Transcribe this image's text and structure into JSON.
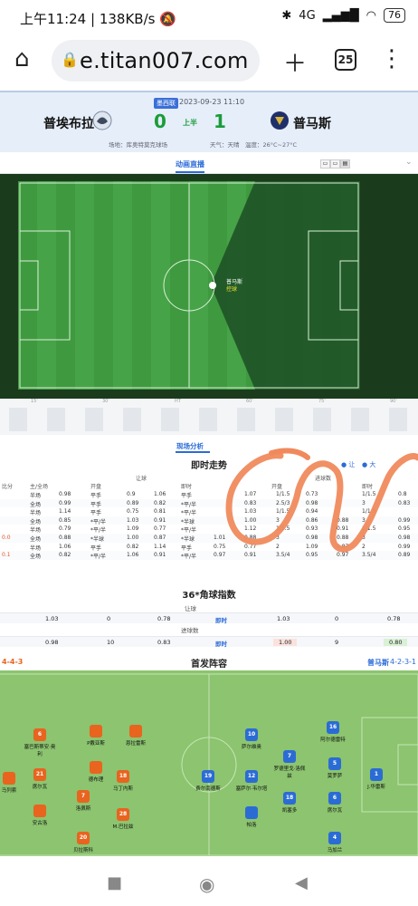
{
  "status_bar": {
    "time": "上午11:24",
    "speed": "138KB/s",
    "network": "4G",
    "battery": "76"
  },
  "browser": {
    "url": "e.titan007.com",
    "tab_count": "25"
  },
  "match": {
    "league": "墨西联",
    "datetime": "2023-09-23 11:10",
    "home_team": "普埃布拉",
    "away_team": "普马斯",
    "home_score": "0",
    "away_score": "1",
    "period": "上半",
    "venue": "场地：库奥特莫克球场",
    "weather": "天气：天晴　温度：26°C~27°C"
  },
  "tabs": {
    "animation": "动画直播"
  },
  "pitch": {
    "event_team": "普马斯",
    "event_text": "控球",
    "timeline_marks": [
      "15'",
      "30'",
      "HT",
      "60'",
      "75'",
      "90'"
    ]
  },
  "analysis": {
    "tab": "现场分析",
    "live_trend_title": "即时走势",
    "asian_label": "让",
    "goals_label": "大",
    "col_handicap": "让球",
    "col_goals": "进球数",
    "col_opening": "开盘",
    "col_live": "即时",
    "rows": [
      {
        "score": "",
        "side": "半场",
        "c1": "0.98",
        "c2": "平手",
        "c3": "0.9",
        "c4": "1.06",
        "c5": "平手",
        "c6": "",
        "c7": "1.07",
        "c8": "1/1.5",
        "c9": "0.73",
        "c10": "",
        "c11": "1/1.5",
        "c12": "0.8"
      },
      {
        "score": "",
        "side": "全场",
        "c1": "0.99",
        "c2": "平手",
        "c3": "0.89",
        "c4": "0.82",
        "c5": "*平/半",
        "c6": "",
        "c7": "0.83",
        "c8": "2.5/3",
        "c9": "0.98",
        "c10": "",
        "c11": "3",
        "c12": "0.83"
      },
      {
        "score": "",
        "side": "半场",
        "c1": "1.14",
        "c2": "平手",
        "c3": "0.75",
        "c4": "0.81",
        "c5": "*平/半",
        "c6": "",
        "c7": "1.03",
        "c8": "1/1.5",
        "c9": "0.94",
        "c10": "",
        "c11": "1/1.5",
        "c12": ""
      },
      {
        "score": "",
        "side": "全场",
        "c1": "0.85",
        "c2": "*平/半",
        "c3": "1.03",
        "c4": "0.91",
        "c5": "*半球",
        "c6": "",
        "c7": "1.00",
        "c8": "3",
        "c9": "0.86",
        "c10": "0.88",
        "c11": "3",
        "c12": "0.99"
      },
      {
        "score": "",
        "side": "半场",
        "c1": "0.79",
        "c2": "*平/半",
        "c3": "1.09",
        "c4": "0.77",
        "c5": "*平/半",
        "c6": "",
        "c7": "1.12",
        "c8": "1/1.5",
        "c9": "0.93",
        "c10": "0.91",
        "c11": "1/1.5",
        "c12": "0.95"
      },
      {
        "score": "0.0",
        "side": "全场",
        "c1": "0.88",
        "c2": "*半球",
        "c3": "1.00",
        "c4": "0.87",
        "c5": "*半球",
        "c6": "1.01",
        "c7": "0.88",
        "c8": "3",
        "c9": "0.98",
        "c10": "0.88",
        "c11": "3",
        "c12": "0.98"
      },
      {
        "score": "",
        "side": "半场",
        "c1": "1.06",
        "c2": "平手",
        "c3": "0.82",
        "c4": "1.14",
        "c5": "平手",
        "c6": "0.75",
        "c7": "0.77",
        "c8": "2",
        "c9": "1.09",
        "c10": "0.87",
        "c11": "2",
        "c12": "0.99"
      },
      {
        "score": "0.1",
        "side": "全场",
        "c1": "0.82",
        "c2": "*平/半",
        "c3": "1.06",
        "c4": "0.91",
        "c5": "*平/半",
        "c6": "0.97",
        "c7": "0.91",
        "c8": "3.5/4",
        "c9": "0.95",
        "c10": "0.97",
        "c11": "3.5/4",
        "c12": "0.89"
      }
    ],
    "left_col_header": "比分",
    "side_header": "主/全场"
  },
  "corner": {
    "title": "36*角球指数",
    "handicap_label": "让球",
    "goals_label": "进球数",
    "live": "即时",
    "row1": {
      "a": "1.03",
      "b": "0",
      "c": "0.78",
      "d": "1.03",
      "e": "0",
      "f": "0.78"
    },
    "row2": {
      "a": "0.98",
      "b": "10",
      "c": "0.83",
      "d": "1.00",
      "e": "9",
      "f": "0.80"
    }
  },
  "lineup": {
    "title": "首发阵容",
    "home_formation": "4-4-3",
    "away_name": "普马斯",
    "away_formation": "4-2-3-1",
    "home_players": [
      {
        "num": "",
        "name": "P戴亚斯"
      },
      {
        "num": "6",
        "name": "塞巴斯蒂安·奥利"
      },
      {
        "num": "",
        "name": "德布理"
      },
      {
        "num": "",
        "name": "恩拉雷斯"
      },
      {
        "num": "",
        "name": "马列索"
      },
      {
        "num": "21",
        "name": "席尔瓦"
      },
      {
        "num": "7",
        "name": "洛佩斯"
      },
      {
        "num": "18",
        "name": "马丁内斯"
      },
      {
        "num": "",
        "name": "安古洛"
      },
      {
        "num": "28",
        "name": "M.巴拉兹"
      },
      {
        "num": "20",
        "name": "贝拉斯科"
      }
    ],
    "away_players": [
      {
        "num": "10",
        "name": "萨尔维奥"
      },
      {
        "num": "16",
        "name": "阿尔德雷特"
      },
      {
        "num": "7",
        "name": "罗德里戈·洛佩兹"
      },
      {
        "num": "5",
        "name": "莫罗萨"
      },
      {
        "num": "19",
        "name": "费尔南德斯"
      },
      {
        "num": "12",
        "name": "塞萨尔·韦尔塔"
      },
      {
        "num": "1",
        "name": "J.华雷斯"
      },
      {
        "num": "18",
        "name": "凯塞多"
      },
      {
        "num": "6",
        "name": "席尔瓦"
      },
      {
        "num": "",
        "name": "帕洛"
      },
      {
        "num": "4",
        "name": "马加兰"
      }
    ]
  },
  "colors": {
    "accent": "#2a6bd8",
    "score_green": "#1a9c3a",
    "home_kit": "#e8641f",
    "away_kit": "#2b6cd4",
    "scribble": "#f08a5d"
  }
}
